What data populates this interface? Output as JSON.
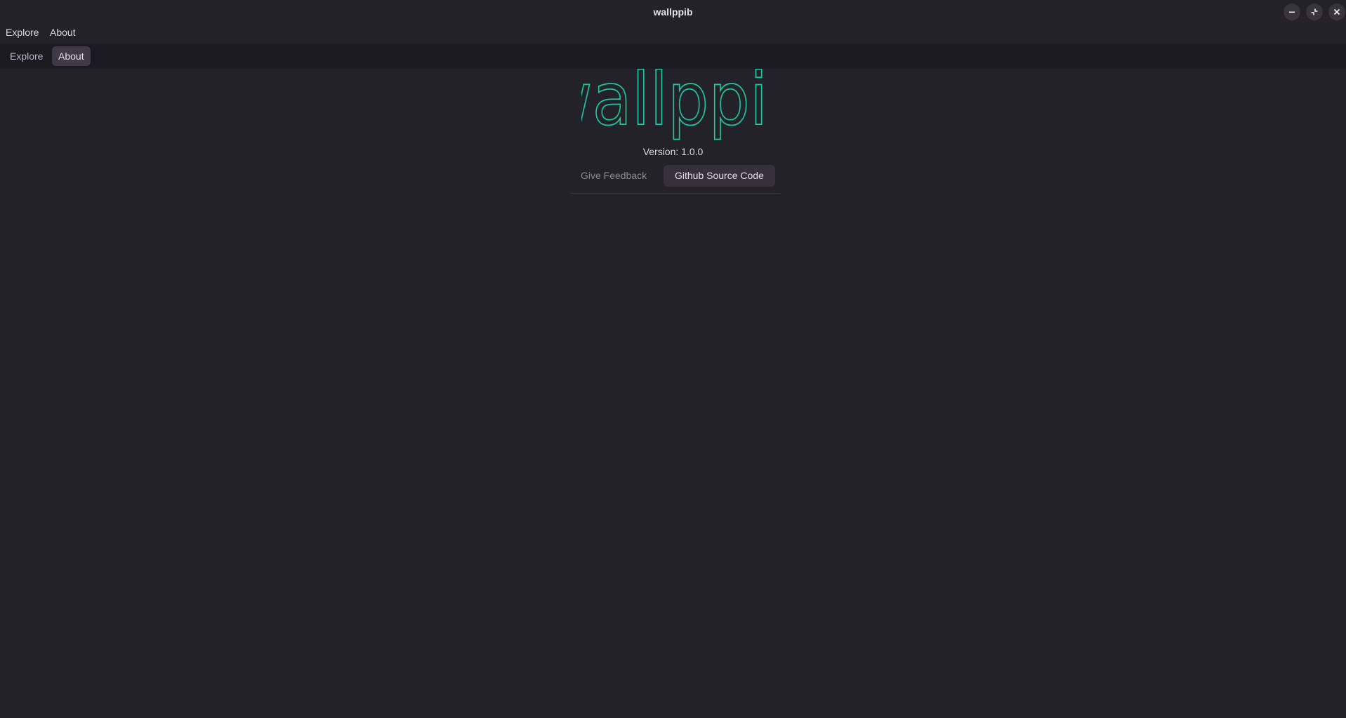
{
  "window": {
    "title": "wallppib",
    "controls": [
      "minimize-icon",
      "restore-icon",
      "close-icon"
    ]
  },
  "menubar": {
    "items": [
      {
        "label": "Explore"
      },
      {
        "label": "About"
      }
    ]
  },
  "tabs": {
    "items": [
      {
        "label": "Explore",
        "active": false
      },
      {
        "label": "About",
        "active": true
      }
    ]
  },
  "about": {
    "logo_text": "wallppib",
    "version": "Version: 1.0.0",
    "feedback_label": "Give Feedback",
    "github_label": "Github Source Code"
  },
  "colors": {
    "background": "#232129",
    "tabbar": "#1b1a20",
    "logo_outline": "#1ec8a0",
    "active_tab": "#3e3a48"
  }
}
